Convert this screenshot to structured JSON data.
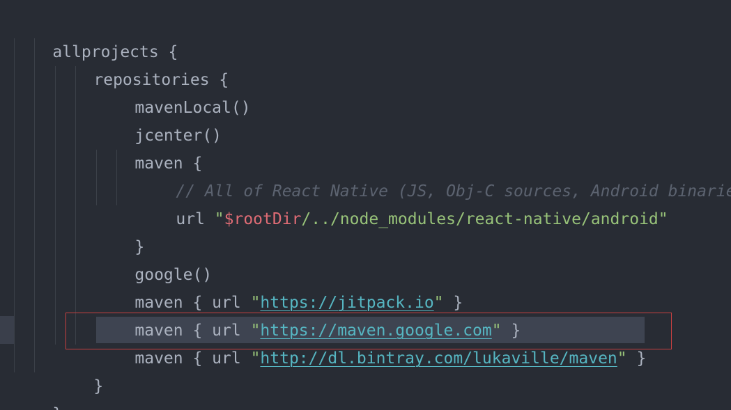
{
  "code": {
    "line1": {
      "text": "allprojects {"
    },
    "line2": {
      "text": "repositories {"
    },
    "line3": {
      "text": "mavenLocal()"
    },
    "line4": {
      "text": "jcenter()"
    },
    "line5": {
      "text": "maven {"
    },
    "line6": {
      "text": "// All of React Native (JS, Obj-C sources, Android binaries"
    },
    "line7": {
      "kw": "url ",
      "q1": "\"",
      "var": "$rootDir",
      "path": "/../node_modules/react-native/android",
      "q2": "\""
    },
    "line8": {
      "text": "}"
    },
    "line9": {
      "text": "google()"
    },
    "line10": {
      "pre": "maven { url ",
      "q1": "\"",
      "url": "https://jitpack.io",
      "q2": "\"",
      "post": " }"
    },
    "line11": {
      "pre": "maven { url ",
      "q1": "\"",
      "url": "https://maven.google.com",
      "q2": "\"",
      "post": " }"
    },
    "line12": {
      "pre": "maven { url ",
      "q1": "\"",
      "url": "http://dl.bintray.com/lukaville/maven",
      "q2": "\"",
      "post": " }"
    },
    "line13": {
      "text": "}"
    },
    "line14": {
      "text": "}"
    }
  },
  "colors": {
    "background": "#282c34",
    "text": "#abb2bf",
    "string": "#98c379",
    "variable": "#e06c75",
    "url": "#56b6c2",
    "comment": "#5c6370",
    "highlight_border": "#c94040"
  }
}
